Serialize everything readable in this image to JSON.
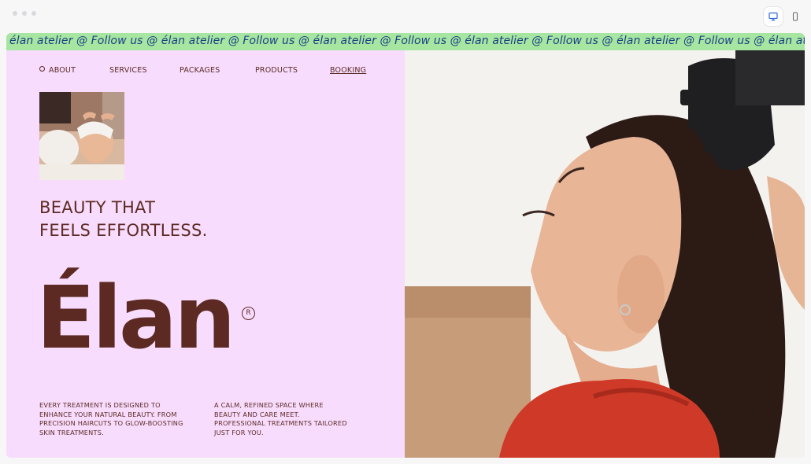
{
  "marquee": {
    "text": "élan atelier @ Follow us @ élan atelier @ Follow us @ élan atelier @ Follow us @ élan atelier @ Follow us @ élan atelier @ Follow us @ élan atelier @ Follow us @ élan atelier @ Follow us @ élan atelier @ Follow us @ élan atelier @ F"
  },
  "nav": {
    "about": "ABOUT",
    "services": "SERVICES",
    "packages": "PACKAGES",
    "products": "PRODUCTS",
    "booking": "BOOKING"
  },
  "hero": {
    "tagline_line1": "BEAUTY THAT",
    "tagline_line2": "FEELS EFFORTLESS.",
    "brand": "Élan",
    "registered": "R"
  },
  "descriptions": {
    "left": "EVERY TREATMENT IS DESIGNED TO ENHANCE YOUR NATURAL BEAUTY. FROM PRECISION HAIRCUTS TO GLOW-BOOSTING SKIN TREATMENTS.",
    "right": "A CALM, REFINED SPACE WHERE BEAUTY AND CARE MEET. PROFESSIONAL TREATMENTS TAILORED JUST FOR YOU."
  },
  "colors": {
    "panel_bg": "#f7dcfd",
    "marquee_bg": "#a6e6a1",
    "marquee_text": "#1b3d86",
    "brand_brown": "#5d2a23",
    "active_device": "#2f6ae0"
  },
  "icons": {
    "desktop": "desktop-icon",
    "mobile": "mobile-icon",
    "nav_bullet": "circle-bullet-icon"
  }
}
